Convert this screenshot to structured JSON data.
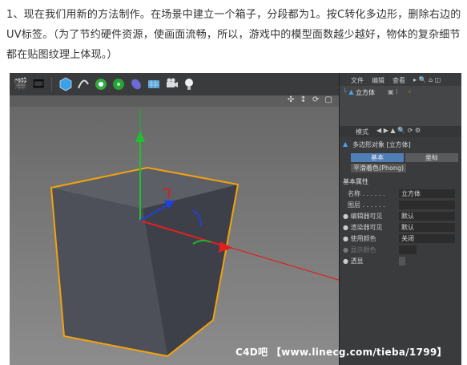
{
  "intro": "1、现在我们用新的方法制作。在场景中建立一个箱子，分段都为1。按C转化多边形，删除右边的UV标签。（为了节约硬件资源，使画面流畅，所以，游戏中的模型面数越少越好，物体的复杂细节都在贴图纹理上体现。）",
  "object_manager": {
    "menu": [
      "文件",
      "编辑",
      "查看"
    ],
    "object_name": "立方体"
  },
  "attributes": {
    "menu_label": "模式",
    "title": "多边形对象 [立方体]",
    "tabs": [
      "基本",
      "坐标"
    ],
    "phong_tab": "平滑着色(Phong)",
    "section": "基本属性",
    "rows": [
      {
        "label": "名称 . . . . . .",
        "value": "立方体"
      },
      {
        "label": "图层 . . . . . .",
        "value": ""
      },
      {
        "label": "编辑器可见",
        "value": "默认"
      },
      {
        "label": "渲染器可见",
        "value": "默认"
      },
      {
        "label": "使用颜色",
        "value": "关闭"
      },
      {
        "label": "显示颜色",
        "value": ""
      },
      {
        "label": "透显",
        "value": ""
      }
    ]
  },
  "watermark": "C4D吧 【www.linecg.com/tieba/1799】",
  "colors": {
    "cube_outline": "#f2a20f",
    "axis_y": "#20c030",
    "axis_x": "#e02020",
    "axis_z": "#2040e0"
  }
}
